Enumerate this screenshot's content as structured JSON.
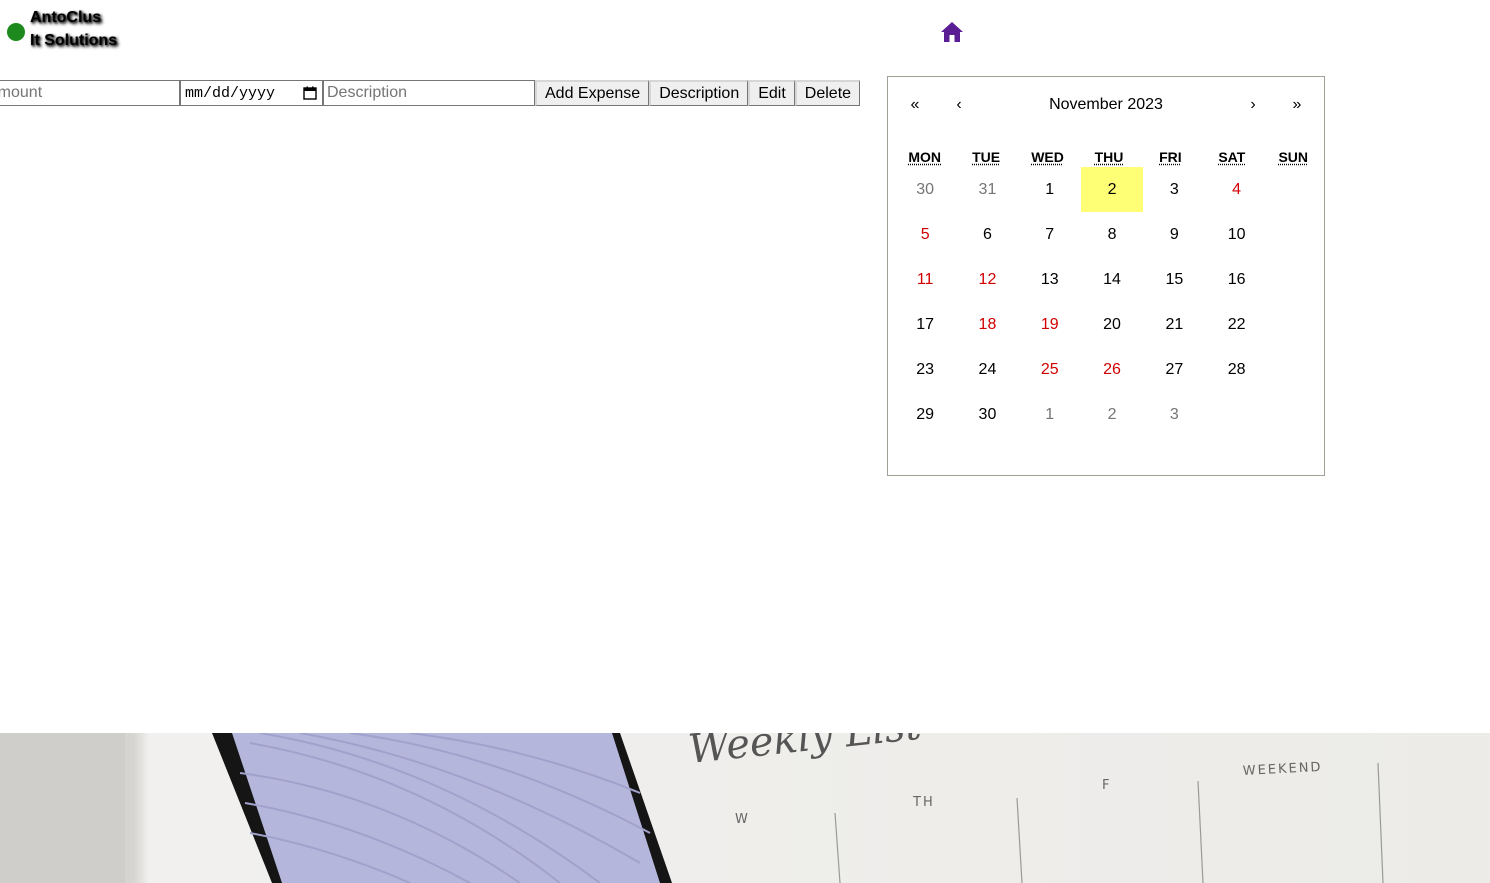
{
  "brand": {
    "line1": "AntoClus",
    "line2": "It Solutions",
    "dot_color": "#1e8a1e"
  },
  "nav": {
    "home_icon": "home-icon",
    "home_color": "#5b1d94"
  },
  "form": {
    "amount_placeholder": "Amount",
    "date_placeholder": "mm/dd/yyyy",
    "description_placeholder": "Description",
    "add_label": "Add Expense",
    "description_label": "Description",
    "edit_label": "Edit",
    "delete_label": "Delete"
  },
  "calendar": {
    "first": "«",
    "prev": "‹",
    "label": "November 2023",
    "next": "›",
    "last": "»",
    "weekdays": [
      "MON",
      "TUE",
      "WED",
      "THU",
      "FRI",
      "SAT",
      "SUN"
    ],
    "days": [
      {
        "d": "30",
        "t": "other"
      },
      {
        "d": "31",
        "t": "other"
      },
      {
        "d": "1",
        "t": ""
      },
      {
        "d": "2",
        "t": "today"
      },
      {
        "d": "3",
        "t": ""
      },
      {
        "d": "4",
        "t": "weekend"
      },
      {
        "d": "5",
        "t": "weekend"
      },
      {
        "d": "6",
        "t": ""
      },
      {
        "d": "7",
        "t": ""
      },
      {
        "d": "8",
        "t": ""
      },
      {
        "d": "9",
        "t": ""
      },
      {
        "d": "10",
        "t": ""
      },
      {
        "d": "11",
        "t": "weekend"
      },
      {
        "d": "12",
        "t": "weekend"
      },
      {
        "d": "13",
        "t": ""
      },
      {
        "d": "14",
        "t": ""
      },
      {
        "d": "15",
        "t": ""
      },
      {
        "d": "16",
        "t": ""
      },
      {
        "d": "17",
        "t": ""
      },
      {
        "d": "18",
        "t": "weekend"
      },
      {
        "d": "19",
        "t": "weekend"
      },
      {
        "d": "20",
        "t": ""
      },
      {
        "d": "21",
        "t": ""
      },
      {
        "d": "22",
        "t": ""
      },
      {
        "d": "23",
        "t": ""
      },
      {
        "d": "24",
        "t": ""
      },
      {
        "d": "25",
        "t": "weekend"
      },
      {
        "d": "26",
        "t": "weekend"
      },
      {
        "d": "27",
        "t": ""
      },
      {
        "d": "28",
        "t": ""
      },
      {
        "d": "29",
        "t": ""
      },
      {
        "d": "30",
        "t": ""
      },
      {
        "d": "1",
        "t": "other"
      },
      {
        "d": "2",
        "t": "other"
      },
      {
        "d": "3",
        "t": "other"
      }
    ],
    "today_color": "#ffff76",
    "weekend_color": "#d10000"
  },
  "banner": {
    "script_text": "Weekly List",
    "col_w": "W",
    "col_th": "TH",
    "col_f": "F",
    "col_weekend": "WEEKEND"
  }
}
